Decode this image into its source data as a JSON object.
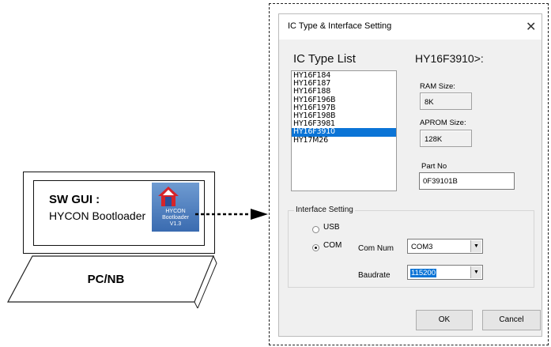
{
  "diagram": {
    "sw_gui_title": "SW GUI :",
    "sw_gui_name": "HYCON Bootloader",
    "app_icon_text": [
      "HYCON",
      "Bootloader",
      "V1.3"
    ],
    "pc_label": "PC/NB"
  },
  "dialog": {
    "title": "IC Type & Interface Setting",
    "close_glyph": "✕",
    "ic_list_label": "IC Type List",
    "selected_ic": "HY16F3910>:",
    "ic_list": [
      "HY16F184",
      "HY16F187",
      "HY16F188",
      "HY16F196B",
      "HY16F197B",
      "HY16F198B",
      "HY16F3981",
      "HY16F3910",
      "HY17M26"
    ],
    "ic_list_selected_index": 7,
    "ram_label": "RAM Size:",
    "ram_value": "8K",
    "aprom_label": "APROM Size:",
    "aprom_value": "128K",
    "partno_label": "Part No",
    "partno_value": "0F39101B",
    "interface_group_label": "Interface Setting",
    "usb_label": "USB",
    "com_label": "COM",
    "selected_interface": "COM",
    "comnum_label": "Com Num",
    "comnum_value": "COM3",
    "baud_label": "Baudrate",
    "baud_value": "115200",
    "ok_label": "OK",
    "cancel_label": "Cancel"
  },
  "colors": {
    "selection": "#0b74d6",
    "dialog_bg": "#f0f0f0"
  }
}
